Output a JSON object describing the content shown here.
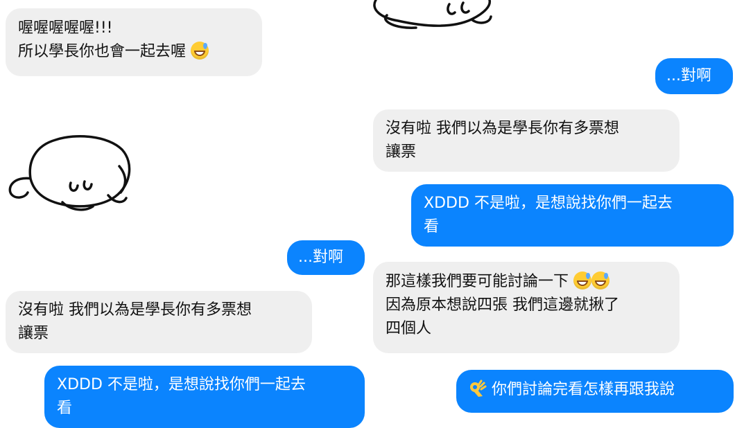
{
  "messages": [
    {
      "id": "m1",
      "side": "incoming",
      "lines": [
        "喔喔喔喔喔!!!",
        "所以學長你也會一起去喔"
      ],
      "emoji": [
        "grinning-sweat"
      ]
    },
    {
      "id": "m2",
      "side": "outgoing",
      "lines": [
        "...對啊"
      ]
    },
    {
      "id": "m3",
      "side": "incoming",
      "lines": [
        "沒有啦 我們以為是學長你有多票想",
        "讓票"
      ]
    },
    {
      "id": "m4",
      "side": "outgoing",
      "lines": [
        "XDDD 不是啦，是想說找你們一起去",
        "看"
      ]
    },
    {
      "id": "m5",
      "side": "outgoing",
      "lines": [
        "...對啊"
      ]
    },
    {
      "id": "m6",
      "side": "incoming",
      "lines": [
        "那這樣我們要可能討論一下",
        "因為原本想說四張 我們這邊就揪了",
        "四個人"
      ],
      "emoji": [
        "grinning-sweat",
        "grinning-sweat"
      ]
    },
    {
      "id": "m7",
      "side": "incoming",
      "lines": [
        "沒有啦 我們以為是學長你有多票想",
        "讓票"
      ]
    },
    {
      "id": "m8",
      "side": "outgoing",
      "lines": [
        "XDDD 不是啦，是想說找你們一起去",
        "看"
      ]
    },
    {
      "id": "m9",
      "side": "outgoing",
      "lines": [
        "你們討論完看怎樣再跟我說"
      ],
      "emoji": [
        "ok-hand"
      ]
    }
  ],
  "stickers": [
    {
      "id": "top",
      "name": "sleeping-bunny-sticker"
    },
    {
      "id": "left",
      "name": "sleeping-bunny-sticker"
    }
  ],
  "colors": {
    "incoming_bg": "#efefef",
    "outgoing_bg": "#0b84fe",
    "incoming_text": "#111111",
    "outgoing_text": "#ffffff"
  }
}
